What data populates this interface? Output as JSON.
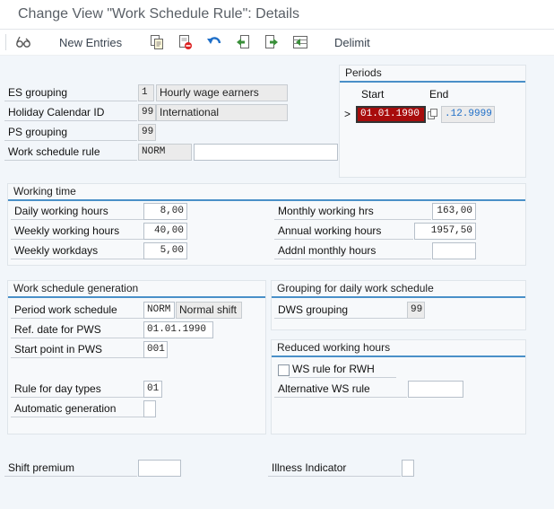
{
  "title": "Change View \"Work Schedule Rule\": Details",
  "toolbar": {
    "new_entries": "New Entries",
    "delimit": "Delimit"
  },
  "header_fields": {
    "es_grouping": {
      "label": "ES grouping",
      "value": "1",
      "text": "Hourly wage earners"
    },
    "holiday_calendar": {
      "label": "Holiday Calendar ID",
      "value": "99",
      "text": "International"
    },
    "ps_grouping": {
      "label": "PS grouping",
      "value": "99"
    },
    "work_schedule_rule": {
      "label": "Work schedule rule",
      "value": "NORM",
      "text": ""
    }
  },
  "periods": {
    "title": "Periods",
    "start_label": "Start",
    "end_label": "End",
    "marker": ">",
    "start": "01.01.1990",
    "end": ".12.9999"
  },
  "working_time": {
    "title": "Working time",
    "daily_hours": {
      "label": "Daily working hours",
      "value": "8,00"
    },
    "weekly_hours": {
      "label": "Weekly working hours",
      "value": "40,00"
    },
    "weekly_workdays": {
      "label": "Weekly workdays",
      "value": "5,00"
    },
    "monthly_hrs": {
      "label": "Monthly working hrs",
      "value": "163,00"
    },
    "annual_hours": {
      "label": "Annual working hours",
      "value": "1957,50"
    },
    "addnl_monthly": {
      "label": "Addnl monthly hours",
      "value": ""
    }
  },
  "ws_generation": {
    "title": "Work schedule generation",
    "period_ws": {
      "label": "Period work schedule",
      "value": "NORM",
      "text": "Normal shift"
    },
    "ref_date": {
      "label": "Ref. date for PWS",
      "value": "01.01.1990"
    },
    "start_point": {
      "label": "Start point in PWS",
      "value": "001"
    },
    "rule_day_types": {
      "label": "Rule for day types",
      "value": "01"
    },
    "auto_generation": {
      "label": "Automatic generation",
      "value": ""
    }
  },
  "dws_grouping_box": {
    "title": "Grouping for daily work schedule",
    "dws_grouping": {
      "label": "DWS grouping",
      "value": "99"
    }
  },
  "reduced_hours": {
    "title": "Reduced working hours",
    "ws_rule_rwh": {
      "label": "WS rule for RWH",
      "checked": false
    },
    "alt_ws_rule": {
      "label": "Alternative WS rule",
      "value": ""
    }
  },
  "bottom": {
    "shift_premium": {
      "label": "Shift premium",
      "value": ""
    },
    "illness_indicator": {
      "label": "Illness Indicator",
      "value": ""
    }
  },
  "colors": {
    "accent": "#4a90c8",
    "selected_bg": "#a80c0c",
    "blue_icon": "#1f6fc8",
    "green_icon": "#3a8f3a"
  },
  "icons": [
    "glasses-icon",
    "copy-icon",
    "delete-icon",
    "undo-icon",
    "previous-entry-icon",
    "next-entry-icon",
    "select-all-icon"
  ]
}
